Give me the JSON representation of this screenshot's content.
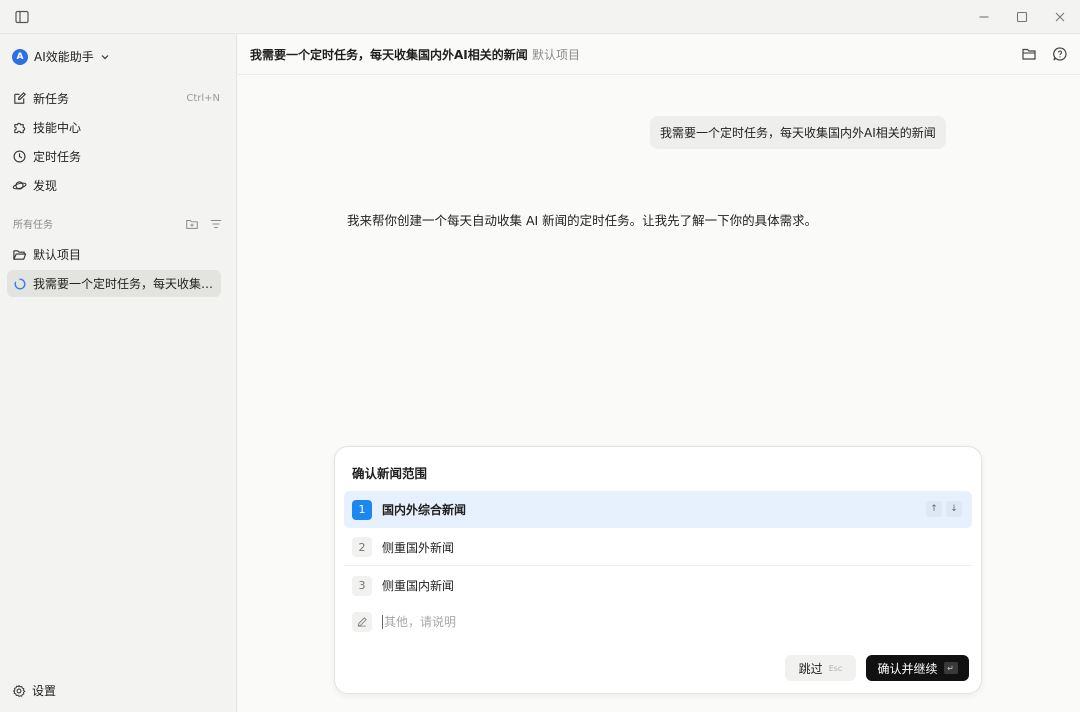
{
  "window": {
    "sidebar_toggle_icon": "sidebar-panel-icon",
    "controls": [
      "minimize-icon",
      "maximize-icon",
      "close-icon"
    ]
  },
  "sidebar": {
    "brand": {
      "avatar_letter": "A",
      "name": "AI效能助手"
    },
    "nav": [
      {
        "label": "新任务",
        "icon": "edit-icon",
        "shortcut": "Ctrl+N"
      },
      {
        "label": "技能中心",
        "icon": "puzzle-icon"
      },
      {
        "label": "定时任务",
        "icon": "clock-icon"
      },
      {
        "label": "发现",
        "icon": "planet-icon"
      }
    ],
    "section_label": "所有任务",
    "projects": [
      {
        "label": "默认项目",
        "icon": "folder-icon"
      }
    ],
    "tasks": [
      {
        "label": "我需要一个定时任务，每天收集…",
        "status": "loading"
      }
    ],
    "settings_label": "设置"
  },
  "header": {
    "title": "我需要一个定时任务，每天收集国内外AI相关的新闻",
    "project": "默认项目"
  },
  "chat": {
    "user_message": "我需要一个定时任务，每天收集国内外AI相关的新闻",
    "assistant_message": "我来帮你创建一个每天自动收集 AI 新闻的定时任务。让我先了解一下你的具体需求。"
  },
  "question_card": {
    "title": "确认新闻范围",
    "options": [
      {
        "num": "1",
        "label": "国内外综合新闻",
        "selected": true
      },
      {
        "num": "2",
        "label": "侧重国外新闻",
        "selected": false
      },
      {
        "num": "3",
        "label": "侧重国内新闻",
        "selected": false
      }
    ],
    "other_placeholder": "其他，请说明",
    "skip_label": "跳过",
    "skip_key": "Esc",
    "confirm_label": "确认并继续",
    "confirm_key": "↵"
  },
  "colors": {
    "accent": "#1d87f0",
    "selected_bg": "#e7f1fd",
    "primary_button": "#111111",
    "sidebar_bg": "#f3f3f1"
  }
}
